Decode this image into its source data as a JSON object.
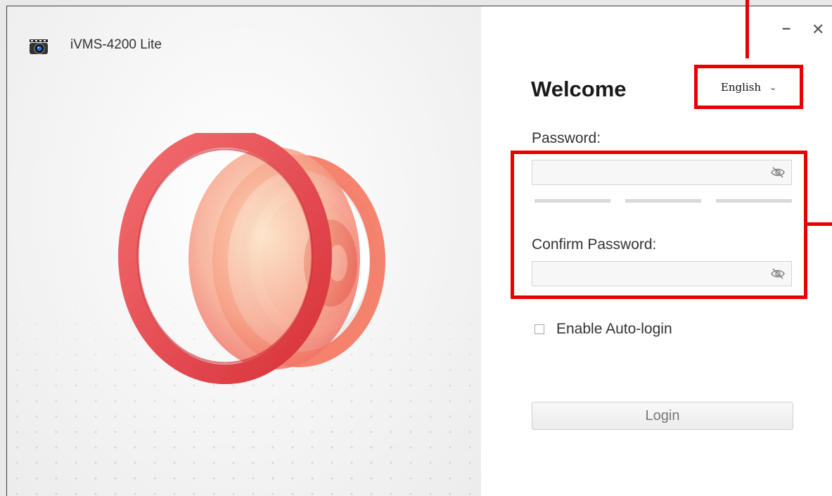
{
  "app": {
    "title": "iVMS-4200 Lite"
  },
  "window_controls": {
    "minimize": "–",
    "close": "✕"
  },
  "welcome": "Welcome",
  "language": {
    "selected": "English",
    "chevron": "⌄"
  },
  "password": {
    "label": "Password:",
    "value": "",
    "placeholder": ""
  },
  "confirm_password": {
    "label": "Confirm Password:",
    "value": "",
    "placeholder": ""
  },
  "auto_login": {
    "label": "Enable Auto-login",
    "checked": false
  },
  "login_button": {
    "label": "Login"
  },
  "colors": {
    "highlight": "#e80000",
    "hero_red": "#e8454a",
    "hero_peach": "#f7b39a"
  },
  "icons": [
    "app-camera-icon",
    "eye-slash-icon",
    "minimize-icon",
    "close-icon",
    "chevron-down-icon"
  ]
}
